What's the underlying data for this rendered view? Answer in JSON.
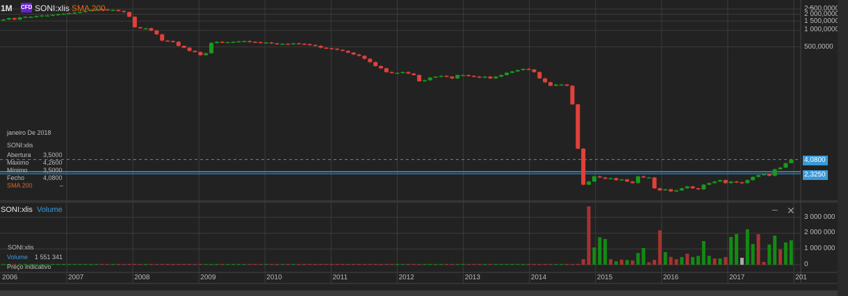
{
  "header": {
    "period": "1M",
    "badge": "CFD",
    "symbol": "SONI:xlis",
    "indicator": "SMA 200"
  },
  "price_axis": {
    "labels": [
      "2 500,0000",
      "2 000,0000",
      "1 500,0000",
      "1 000,0000",
      "500,0000"
    ],
    "levels": [
      2500,
      2000,
      1500,
      1000,
      500
    ]
  },
  "tags": {
    "last": "4,0800",
    "last_value": 4.08,
    "line": "2,3250",
    "line_value": 2.325
  },
  "info": {
    "date": "janeiro De 2018",
    "symbol": "SONI:xlis",
    "rows": [
      {
        "k": "Abertura",
        "v": "3,5000"
      },
      {
        "k": "Máximo",
        "v": "4,2600"
      },
      {
        "k": "Mínimo",
        "v": "3,5000"
      },
      {
        "k": "Fecho",
        "v": "4,0800"
      }
    ],
    "sma_label": "SMA 200",
    "sma_value": "–"
  },
  "volume_panel": {
    "symbol": "SONI:xlis",
    "title": "Volume",
    "info_symbol": "SONI:xlis",
    "info_label": "Volume",
    "info_value": "1 551 341",
    "note": "Preço indicativo",
    "minimize": "–",
    "close": "✕",
    "axis_labels": [
      "3 000 000",
      "2 000 000",
      "1 000 000",
      "0"
    ],
    "axis_levels": [
      3000000,
      2000000,
      1000000,
      0
    ]
  },
  "time_axis": [
    "2006",
    "2007",
    "2008",
    "2009",
    "2010",
    "2011",
    "2012",
    "2013",
    "2014",
    "2015",
    "2016",
    "2017",
    "201"
  ],
  "colors": {
    "up": "#1a9a1a",
    "down": "#e0413a",
    "vol_up": "#138a13",
    "vol_down": "#a83232",
    "accent": "#3a9ad9",
    "sma": "#e0661e"
  },
  "chart_data": {
    "type": "candlestick",
    "start": "2006-01",
    "interval": "1M",
    "closes": [
      1600,
      1700,
      1600,
      1750,
      1800,
      1800,
      1850,
      1900,
      1900,
      1950,
      2000,
      2050,
      2100,
      2150,
      2200,
      2300,
      2400,
      2500,
      2450,
      2400,
      2400,
      2300,
      2200,
      1800,
      1150,
      1100,
      1100,
      1000,
      850,
      650,
      640,
      620,
      520,
      480,
      420,
      400,
      350,
      380,
      590,
      620,
      600,
      610,
      620,
      630,
      640,
      620,
      610,
      600,
      600,
      580,
      560,
      570,
      560,
      580,
      570,
      560,
      540,
      520,
      480,
      470,
      460,
      440,
      420,
      390,
      360,
      340,
      300,
      260,
      220,
      200,
      170,
      165,
      165,
      170,
      160,
      150,
      115,
      120,
      135,
      140,
      145,
      140,
      130,
      150,
      150,
      145,
      140,
      135,
      140,
      130,
      140,
      150,
      165,
      175,
      185,
      195,
      190,
      170,
      130,
      110,
      95,
      100,
      100,
      95,
      43,
      6.5,
      1.4,
      1.6,
      2.0,
      1.9,
      1.8,
      1.85,
      1.7,
      1.75,
      1.6,
      1.5,
      2.0,
      1.9,
      1.9,
      1.2,
      1.1,
      1.15,
      1.05,
      1.1,
      1.2,
      1.3,
      1.2,
      1.15,
      1.4,
      1.5,
      1.6,
      1.7,
      1.5,
      1.6,
      1.55,
      1.5,
      1.7,
      1.95,
      2.1,
      2.2,
      2.05,
      2.7,
      2.9,
      3.5,
      4.08
    ],
    "last_candle": {
      "open": 3.5,
      "high": 4.26,
      "low": 3.5,
      "close": 4.08
    },
    "volume_recent": [
      350000,
      3700000,
      1100000,
      1740000,
      1630000,
      350000,
      220000,
      320000,
      300000,
      270000,
      740000,
      1060000,
      150000,
      310000,
      2180000,
      800000,
      500000,
      350000,
      490000,
      700000,
      490000,
      560000,
      1500000,
      560000,
      400000,
      400000,
      490000,
      1760000,
      1950000,
      440000,
      2250000,
      1320000,
      1940000,
      180000,
      1280000,
      1850000,
      970000,
      1410000,
      1551341
    ],
    "volume_recent_colors": [
      "d",
      "d",
      "u",
      "u",
      "u",
      "d",
      "u",
      "d",
      "u",
      "d",
      "u",
      "u",
      "d",
      "d",
      "d",
      "u",
      "d",
      "d",
      "u",
      "d",
      "u",
      "u",
      "u",
      "u",
      "d",
      "u",
      "d",
      "u",
      "u",
      "n",
      "u",
      "u",
      "d",
      "d",
      "u",
      "u",
      "d",
      "u",
      "u"
    ],
    "volume_early": 50000,
    "price_scale": "log"
  }
}
